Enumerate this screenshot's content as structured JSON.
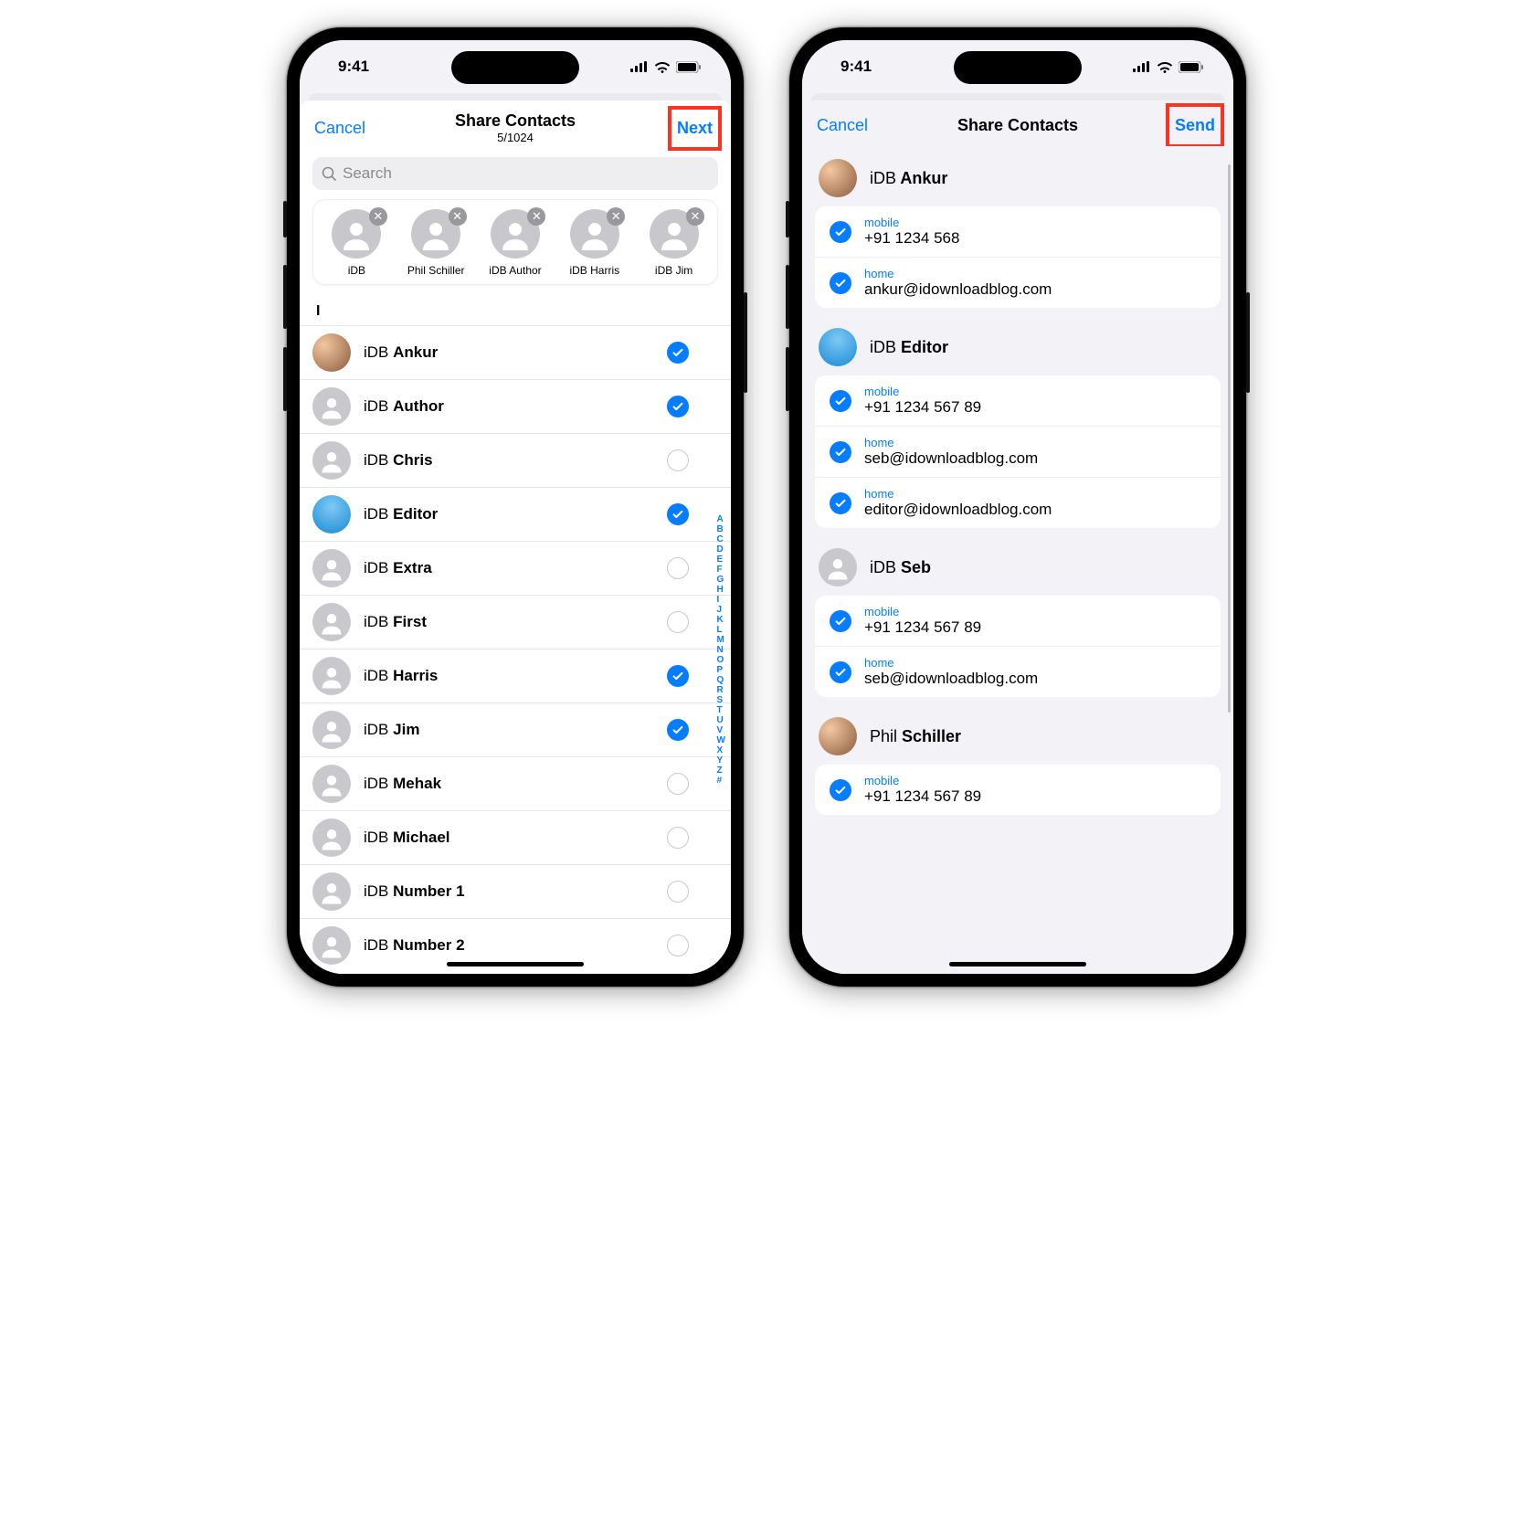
{
  "status": {
    "time": "9:41"
  },
  "left": {
    "nav": {
      "cancel": "Cancel",
      "title": "Share Contacts",
      "count": "5/1024",
      "next": "Next"
    },
    "search_placeholder": "Search",
    "chips": [
      {
        "label": "iDB"
      },
      {
        "label": "Phil Schiller"
      },
      {
        "label": "iDB Author"
      },
      {
        "label": "iDB Harris"
      },
      {
        "label": "iDB Jim"
      }
    ],
    "section": "I",
    "contacts": [
      {
        "first": "iDB",
        "last": "Ankur",
        "selected": true,
        "avatar": "photo1"
      },
      {
        "first": "iDB",
        "last": "Author",
        "selected": true,
        "avatar": ""
      },
      {
        "first": "iDB",
        "last": "Chris",
        "selected": false,
        "avatar": ""
      },
      {
        "first": "iDB",
        "last": "Editor",
        "selected": true,
        "avatar": "photo2"
      },
      {
        "first": "iDB",
        "last": "Extra",
        "selected": false,
        "avatar": ""
      },
      {
        "first": "iDB",
        "last": "First",
        "selected": false,
        "avatar": ""
      },
      {
        "first": "iDB",
        "last": "Harris",
        "selected": true,
        "avatar": ""
      },
      {
        "first": "iDB",
        "last": "Jim",
        "selected": true,
        "avatar": ""
      },
      {
        "first": "iDB",
        "last": "Mehak",
        "selected": false,
        "avatar": ""
      },
      {
        "first": "iDB",
        "last": "Michael",
        "selected": false,
        "avatar": ""
      },
      {
        "first": "iDB",
        "last": "Number 1",
        "selected": false,
        "avatar": ""
      },
      {
        "first": "iDB",
        "last": "Number 2",
        "selected": false,
        "avatar": ""
      }
    ],
    "index": [
      "A",
      "B",
      "C",
      "D",
      "E",
      "F",
      "G",
      "H",
      "I",
      "J",
      "K",
      "L",
      "M",
      "N",
      "O",
      "P",
      "Q",
      "R",
      "S",
      "T",
      "U",
      "V",
      "W",
      "X",
      "Y",
      "Z",
      "#"
    ]
  },
  "right": {
    "nav": {
      "cancel": "Cancel",
      "title": "Share Contacts",
      "send": "Send"
    },
    "cards": [
      {
        "name_first": "iDB",
        "name_last": "Ankur",
        "avatar": "photo1",
        "fields": [
          {
            "label": "mobile",
            "value": "+91 1234 568"
          },
          {
            "label": "home",
            "value": "ankur@idownloadblog.com"
          }
        ]
      },
      {
        "name_first": "iDB",
        "name_last": "Editor",
        "avatar": "photo2",
        "fields": [
          {
            "label": "mobile",
            "value": "+91 1234 567 89"
          },
          {
            "label": "home",
            "value": "seb@idownloadblog.com"
          },
          {
            "label": "home",
            "value": "editor@idownloadblog.com"
          }
        ]
      },
      {
        "name_first": "iDB",
        "name_last": "Seb",
        "avatar": "",
        "fields": [
          {
            "label": "mobile",
            "value": "+91 1234 567 89"
          },
          {
            "label": "home",
            "value": "seb@idownloadblog.com"
          }
        ]
      },
      {
        "name_first": "Phil",
        "name_last": "Schiller",
        "avatar": "photo1",
        "fields": [
          {
            "label": "mobile",
            "value": "+91 1234 567 89"
          }
        ]
      }
    ]
  }
}
